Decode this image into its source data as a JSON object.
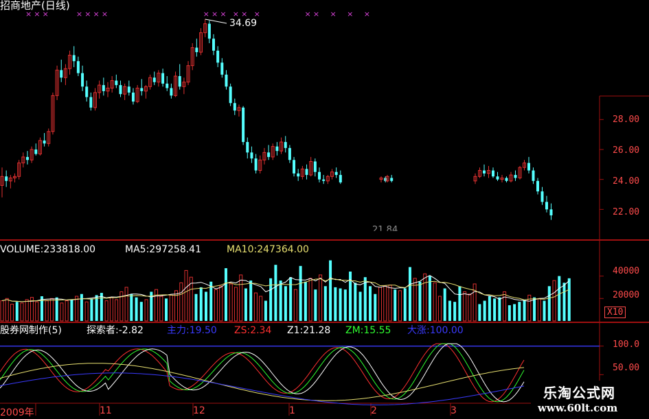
{
  "header": {
    "title": "招商地产(日线)",
    "high_label": "34.69",
    "low_label": "21.84"
  },
  "price_axis": {
    "ticks": [
      "28.00",
      "26.00",
      "24.00",
      "22.00"
    ]
  },
  "volume_panel": {
    "volume_label": "VOLUME:233818.00",
    "ma5_label": "MA5:297258.41",
    "ma10_label": "MA10:247364.00",
    "ticks": [
      "40000",
      "20000"
    ],
    "multiplier": "X10"
  },
  "indicator_panel": {
    "name": "股券网制作(5)",
    "explorer": "探索者:-2.82",
    "zhuli": "主力:19.50",
    "zs": "ZS:2.34",
    "z1": "Z1:21.28",
    "zm": "ZM:15.55",
    "dazhang": "大涨:100.00",
    "ticks": [
      "100.0",
      "50.00"
    ]
  },
  "x_axis": {
    "labels": [
      "2009年",
      "11",
      "12",
      "1",
      "2",
      "3"
    ]
  },
  "watermark": {
    "name": "乐淘公式网",
    "url": "www.60lt.com"
  },
  "colors": {
    "up": "#e03030",
    "down": "#55ffff",
    "grid": "#a01010",
    "axis_text": "#ff4b4b",
    "ma5": "#ffffff",
    "ma10": "#e8e070",
    "signal": "#dd44dd"
  },
  "chart_data": {
    "type": "candlestick",
    "price_ylim": [
      20.0,
      35.8
    ],
    "candles": [
      [
        23.6,
        24.8,
        22.8,
        24.2
      ],
      [
        24.2,
        24.6,
        23.5,
        23.9
      ],
      [
        23.9,
        24.3,
        23.4,
        24.1
      ],
      [
        24.1,
        24.4,
        23.8,
        24.2
      ],
      [
        24.2,
        25.3,
        24.0,
        25.1
      ],
      [
        25.1,
        25.8,
        24.8,
        25.5
      ],
      [
        25.5,
        25.9,
        25.0,
        25.3
      ],
      [
        25.3,
        26.2,
        25.1,
        26.0
      ],
      [
        26.0,
        26.4,
        25.6,
        25.7
      ],
      [
        25.7,
        26.8,
        25.6,
        26.6
      ],
      [
        26.6,
        27.1,
        26.2,
        26.4
      ],
      [
        26.4,
        27.4,
        26.2,
        27.2
      ],
      [
        27.2,
        29.8,
        27.0,
        29.6
      ],
      [
        29.6,
        31.6,
        29.3,
        31.3
      ],
      [
        31.3,
        32.0,
        30.5,
        30.8
      ],
      [
        30.8,
        31.7,
        30.3,
        31.4
      ],
      [
        31.4,
        32.6,
        31.0,
        32.3
      ],
      [
        32.3,
        32.9,
        31.5,
        31.9
      ],
      [
        31.9,
        32.2,
        30.9,
        31.1
      ],
      [
        31.1,
        31.6,
        29.9,
        30.2
      ],
      [
        30.2,
        30.6,
        29.2,
        29.5
      ],
      [
        29.5,
        29.8,
        28.6,
        28.8
      ],
      [
        28.8,
        30.1,
        28.6,
        29.8
      ],
      [
        29.8,
        30.6,
        29.4,
        30.3
      ],
      [
        30.3,
        30.8,
        29.6,
        29.9
      ],
      [
        29.9,
        30.5,
        29.5,
        30.1
      ],
      [
        30.1,
        30.9,
        29.8,
        30.6
      ],
      [
        30.6,
        31.0,
        30.1,
        30.3
      ],
      [
        30.3,
        30.6,
        29.5,
        29.7
      ],
      [
        29.7,
        30.4,
        29.3,
        30.2
      ],
      [
        30.2,
        30.6,
        29.6,
        29.8
      ],
      [
        29.8,
        30.1,
        29.0,
        29.2
      ],
      [
        29.2,
        30.3,
        29.1,
        30.1
      ],
      [
        30.1,
        30.7,
        29.6,
        29.9
      ],
      [
        29.9,
        30.3,
        29.4,
        30.2
      ],
      [
        30.2,
        31.0,
        30.0,
        30.8
      ],
      [
        30.8,
        31.2,
        30.3,
        30.5
      ],
      [
        30.5,
        31.3,
        30.2,
        31.1
      ],
      [
        31.1,
        31.4,
        30.2,
        30.4
      ],
      [
        30.4,
        30.9,
        29.9,
        30.1
      ],
      [
        30.1,
        30.4,
        29.4,
        29.6
      ],
      [
        29.6,
        31.2,
        29.5,
        30.9
      ],
      [
        30.9,
        31.7,
        30.0,
        30.2
      ],
      [
        30.2,
        30.8,
        29.7,
        30.5
      ],
      [
        30.5,
        31.9,
        30.3,
        31.6
      ],
      [
        31.6,
        33.1,
        31.3,
        32.8
      ],
      [
        32.8,
        33.4,
        32.2,
        32.5
      ],
      [
        32.5,
        34.1,
        32.3,
        33.8
      ],
      [
        33.8,
        34.7,
        33.5,
        34.4
      ],
      [
        34.4,
        34.6,
        33.1,
        33.4
      ],
      [
        33.4,
        33.7,
        32.3,
        32.6
      ],
      [
        32.6,
        32.9,
        31.5,
        31.8
      ],
      [
        31.8,
        32.1,
        30.8,
        31.0
      ],
      [
        31.0,
        31.3,
        30.0,
        30.2
      ],
      [
        30.2,
        30.4,
        28.9,
        29.1
      ],
      [
        29.1,
        29.4,
        28.3,
        28.6
      ],
      [
        28.6,
        29.0,
        28.2,
        28.8
      ],
      [
        28.8,
        28.9,
        26.3,
        26.5
      ],
      [
        26.5,
        26.8,
        25.4,
        25.8
      ],
      [
        25.8,
        26.2,
        25.1,
        25.4
      ],
      [
        25.4,
        25.7,
        24.4,
        24.6
      ],
      [
        24.6,
        25.6,
        24.4,
        25.3
      ],
      [
        25.3,
        26.1,
        25.0,
        25.8
      ],
      [
        25.8,
        26.3,
        25.3,
        25.5
      ],
      [
        25.5,
        26.4,
        25.3,
        26.2
      ],
      [
        26.2,
        26.5,
        25.6,
        25.9
      ],
      [
        25.9,
        26.8,
        25.7,
        26.5
      ],
      [
        26.5,
        26.9,
        25.8,
        26.1
      ],
      [
        26.1,
        26.3,
        25.1,
        25.3
      ],
      [
        25.3,
        25.5,
        24.2,
        24.4
      ],
      [
        24.4,
        24.7,
        23.9,
        24.2
      ],
      [
        24.2,
        24.9,
        24.0,
        24.7
      ],
      [
        24.7,
        25.0,
        24.0,
        24.3
      ],
      [
        24.3,
        25.5,
        24.2,
        25.2
      ],
      [
        25.2,
        25.4,
        24.2,
        24.5
      ],
      [
        24.5,
        24.8,
        23.8,
        24.0
      ],
      [
        24.0,
        24.3,
        23.7,
        23.9
      ],
      [
        23.9,
        24.3,
        23.7,
        24.2
      ],
      [
        24.2,
        24.7,
        24.0,
        24.5
      ],
      [
        24.5,
        24.8,
        24.1,
        24.3
      ],
      [
        24.3,
        24.6,
        23.7,
        23.8
      ],
      [
        24.0,
        24.2,
        23.8,
        24.1
      ],
      [
        24.1,
        24.2,
        23.8,
        23.9
      ],
      [
        23.9,
        24.3,
        23.8,
        24.2
      ],
      [
        24.1,
        24.3,
        23.8,
        23.9
      ],
      [
        23.9,
        24.4,
        23.7,
        24.2
      ],
      [
        24.2,
        24.8,
        24.1,
        24.6
      ],
      [
        24.6,
        25.0,
        24.2,
        24.4
      ],
      [
        24.4,
        24.9,
        24.1,
        24.6
      ],
      [
        24.6,
        24.8,
        24.1,
        24.2
      ],
      [
        24.2,
        24.5,
        23.9,
        24.0
      ],
      [
        24.0,
        24.3,
        23.8,
        24.1
      ],
      [
        24.1,
        24.2,
        23.8,
        23.9
      ],
      [
        23.9,
        24.5,
        23.8,
        24.3
      ],
      [
        24.3,
        24.6,
        23.9,
        24.1
      ],
      [
        24.1,
        24.9,
        24.0,
        24.8
      ],
      [
        24.8,
        25.3,
        24.6,
        25.1
      ],
      [
        25.1,
        25.5,
        24.4,
        24.6
      ],
      [
        24.6,
        24.8,
        23.7,
        23.9
      ],
      [
        23.9,
        24.1,
        23.0,
        23.2
      ],
      [
        23.2,
        23.5,
        22.3,
        22.5
      ],
      [
        22.5,
        22.9,
        21.8,
        22.0
      ],
      [
        22.0,
        22.4,
        21.3,
        21.6
      ]
    ],
    "volume_ylim": [
      0,
      55000
    ],
    "volumes": [
      18000,
      20000,
      15000,
      17000,
      16000,
      19000,
      21000,
      17000,
      22000,
      18000,
      20000,
      21000,
      16000,
      18000,
      19000,
      22000,
      24000,
      17000,
      20000,
      23000,
      25000,
      18000,
      21000,
      19000,
      26000,
      30000,
      24000,
      21000,
      17000,
      19000,
      26000,
      28000,
      22000,
      20000,
      23000,
      27000,
      34000,
      45000,
      39000,
      24000,
      30000,
      26000,
      35000,
      28000,
      31000,
      47000,
      33000,
      30000,
      41000,
      29000,
      36000,
      25000,
      22000,
      18000,
      38000,
      50000,
      36000,
      31000,
      39000,
      28000,
      49000,
      35000,
      38000,
      28000,
      41000,
      31000,
      54000,
      30000,
      29000,
      28000,
      44000,
      34000,
      26000,
      39000,
      31000,
      24000,
      30000,
      31000,
      32000,
      28000,
      27000,
      29000,
      48000,
      38000,
      35000,
      42000,
      40000,
      34000,
      22000,
      29000,
      18000,
      17000,
      31000,
      26000,
      24000,
      33000,
      15000,
      18000,
      22000,
      20000,
      21000,
      26000,
      14000,
      15000,
      17000,
      19000,
      23000,
      21000,
      20000,
      18000,
      31000,
      36000,
      40000,
      34000,
      38000
    ]
  }
}
